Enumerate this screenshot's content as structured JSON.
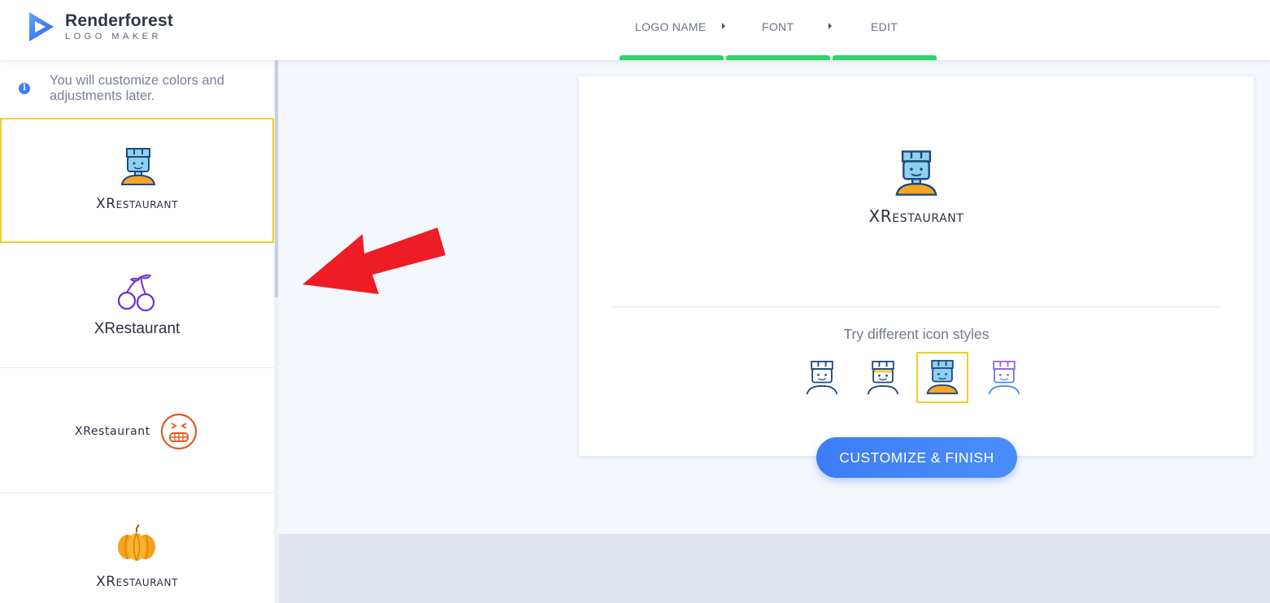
{
  "app": {
    "brand_name": "Renderforest",
    "brand_sub": "LOGO MAKER"
  },
  "steps": [
    {
      "label": "LOGO NAME"
    },
    {
      "label": "FONT"
    },
    {
      "label": "EDIT"
    }
  ],
  "sidebar": {
    "info_text": "You will customize colors and adjustments later.",
    "cards": [
      {
        "label": "XRestaurant",
        "icon": "chef-icon",
        "selected": true
      },
      {
        "label": "XRestaurant",
        "icon": "cherry-icon",
        "selected": false
      },
      {
        "label": "XRestaurant",
        "icon": "grimace-face-icon",
        "selected": false
      },
      {
        "label": "XRestaurant",
        "icon": "pumpkin-icon",
        "selected": false
      }
    ]
  },
  "preview": {
    "logo_label": "XRestaurant",
    "styles_title": "Try different icon styles",
    "style_options": [
      "outline",
      "outline-accent",
      "filled",
      "gradient"
    ],
    "active_style": "filled"
  },
  "cta": {
    "label": "CUSTOMIZE & FINISH"
  },
  "colors": {
    "accent_blue": "#3e7ef8",
    "step_green": "#2fd56b",
    "selected_border": "#f0cd2f",
    "arrow_red": "#ee1c25"
  }
}
